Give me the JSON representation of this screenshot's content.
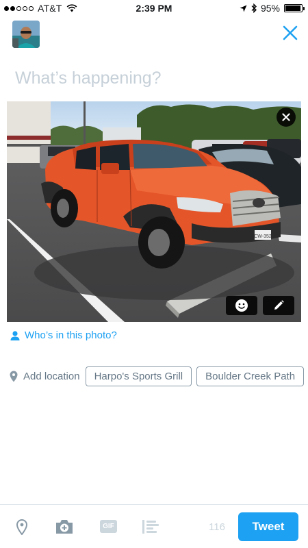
{
  "status_bar": {
    "carrier": "AT&T",
    "time": "2:39 PM",
    "battery_percent": "95%",
    "battery_level": 0.95,
    "signal_bars_filled": 2,
    "signal_bars_total": 5
  },
  "compose": {
    "placeholder": "What’s happening?",
    "value": ""
  },
  "photo": {
    "plate_text": "CW-352"
  },
  "tag_people": {
    "label": "Who’s in this photo?"
  },
  "location": {
    "add_label": "Add location",
    "suggestions": [
      "Harpo's Sports Grill",
      "Boulder Creek Path"
    ]
  },
  "toolbar": {
    "gif_label": "GIF",
    "char_count": "116",
    "tweet_label": "Tweet"
  },
  "colors": {
    "accent": "#1da1f2",
    "muted": "#657786",
    "disabled": "#ccd6dd"
  },
  "icons": [
    "location-arrow-icon",
    "bluetooth-icon",
    "close-icon",
    "face-icon",
    "pencil-icon",
    "person-icon",
    "pin-icon",
    "camera-icon",
    "gif-icon",
    "poll-icon"
  ]
}
